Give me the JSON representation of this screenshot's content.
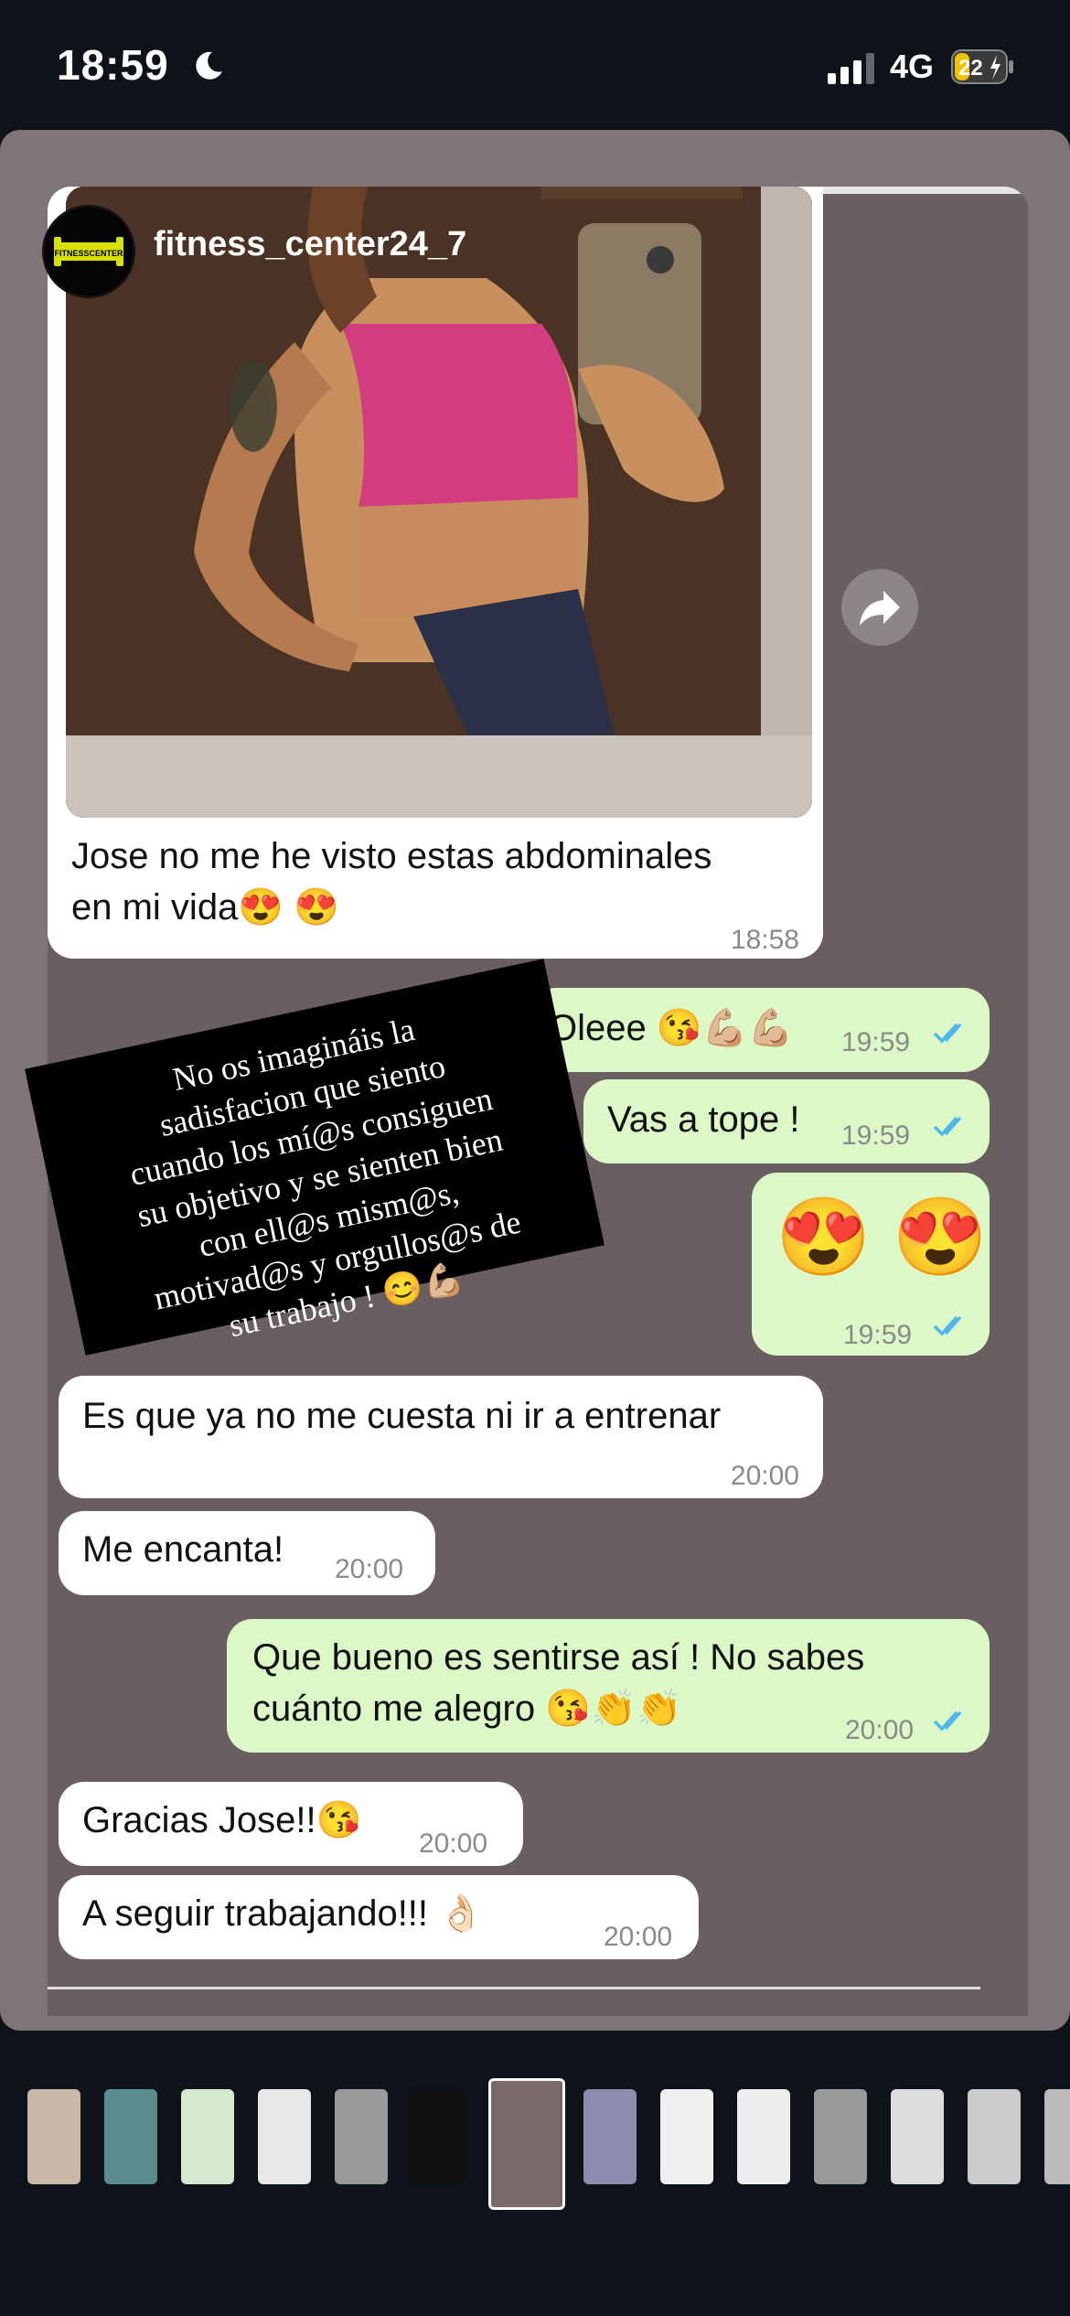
{
  "status_bar": {
    "time": "18:59",
    "network": "4G",
    "battery": "22"
  },
  "story": {
    "account_name": "fitness_center24_7",
    "avatar_text": "FITNESSCENTER"
  },
  "messages": [
    {
      "type": "incoming",
      "text_line1": "Jose no me he visto estas abdominales",
      "text_line2": "en mi vida😍 😍",
      "time": "18:58",
      "has_photo": true
    },
    {
      "type": "outgoing",
      "text": "Oleee 😘💪🏼💪🏼",
      "time": "19:59"
    },
    {
      "type": "outgoing",
      "text": "Vas a tope !",
      "time": "19:59"
    },
    {
      "type": "outgoing",
      "text": "😍 😍",
      "time": "19:59"
    },
    {
      "type": "incoming",
      "text": "Es que ya no me cuesta ni ir a entrenar",
      "time": "20:00"
    },
    {
      "type": "incoming",
      "text": "Me encanta!",
      "time": "20:00"
    },
    {
      "type": "outgoing",
      "text_line1": "Que bueno es sentirse así ! No sabes",
      "text_line2": "cuánto me alegro 😘👏👏",
      "time": "20:00"
    },
    {
      "type": "incoming",
      "text": "Gracias Jose!!😘",
      "time": "20:00"
    },
    {
      "type": "incoming",
      "text": "A seguir trabajando!!! 👌🏻",
      "time": "20:00"
    }
  ],
  "overlay_caption": {
    "line1": "No os imagináis la",
    "line2": "sadisfacion que siento",
    "line3": "cuando los mí@s consiguen",
    "line4": "su objetivo y se sienten bien",
    "line5": "con ell@s mism@s,",
    "line6": "motivad@s y orgullos@s de",
    "line7": "su trabajo ! 😊💪🏼"
  },
  "thumbnail_strip": {
    "count": 14,
    "active_index": 6
  },
  "colors": {
    "incoming_bubble": "#ffffff",
    "outgoing_bubble": "#dcf8c6",
    "tick_blue": "#4fb6ec",
    "background": "#0d1318"
  },
  "icons": [
    "moon-icon",
    "signal-icon",
    "battery-icon",
    "share-icon",
    "double-check-icon"
  ]
}
